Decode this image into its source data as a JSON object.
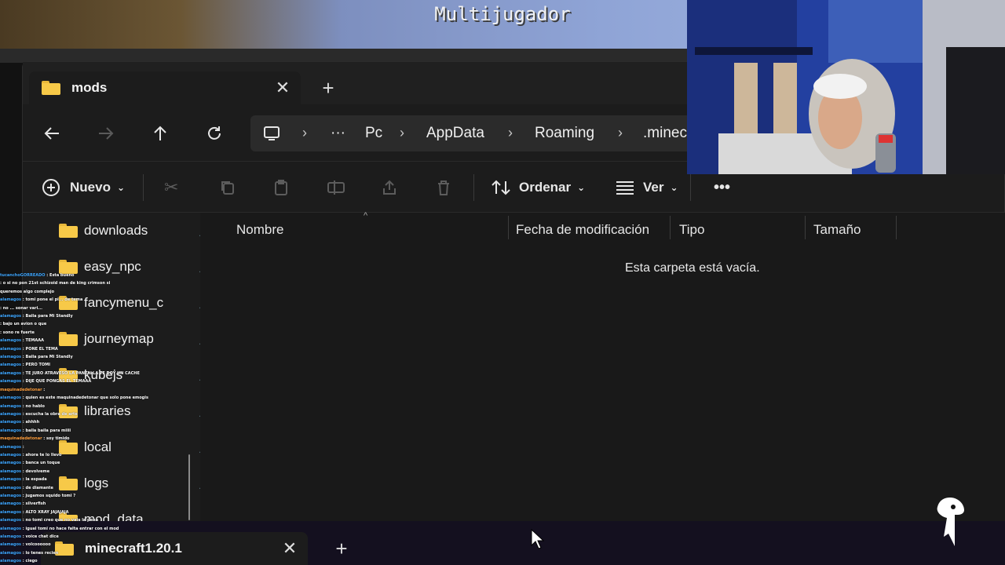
{
  "minecraft": {
    "title": "Multijugador"
  },
  "explorer": {
    "tab": {
      "label": "mods"
    },
    "breadcrumbs": [
      "Pc",
      "AppData",
      "Roaming",
      ".minec"
    ],
    "more_breadcrumbs": "···",
    "commands": {
      "new_label": "Nuevo",
      "sort_label": "Ordenar",
      "view_label": "Ver",
      "more_label": "•••"
    },
    "nav_items": [
      {
        "label": "downloads"
      },
      {
        "label": "easy_npc"
      },
      {
        "label": "fancymenu_c"
      },
      {
        "label": "journeymap"
      },
      {
        "label": "kubejs"
      },
      {
        "label": "libraries"
      },
      {
        "label": "local"
      },
      {
        "label": "logs"
      },
      {
        "label": "mod_data"
      }
    ],
    "columns": [
      "Nombre",
      "Fecha de modificación",
      "Tipo",
      "Tamaño"
    ],
    "empty_message": "Esta carpeta está vacía."
  },
  "bottom_window": {
    "tab": {
      "label": "minecraft1.20.1"
    }
  },
  "chat": [
    {
      "user": "tucanchoGORREADO",
      "text": "Esta bueno"
    },
    {
      "user": "",
      "text": "o si no pon 21st schizoid man de king crimson si"
    },
    {
      "user": "",
      "text": "queremos algo complejo"
    },
    {
      "user": "alamagos",
      "text": "tomi pone el pi... de tema"
    },
    {
      "user": "",
      "text": "no ... sonar vari..."
    },
    {
      "user": "alamagos",
      "text": "Baila para Mi Standly"
    },
    {
      "user": "",
      "text": "bajo un avion o que"
    },
    {
      "user": "",
      "text": "sono re fuerte"
    },
    {
      "user": "alamagos",
      "text": "TEMAAA"
    },
    {
      "user": "alamagos",
      "text": "PONE EL TEMA"
    },
    {
      "user": "alamagos",
      "text": "Baila para Mi Standly"
    },
    {
      "user": "alamagos",
      "text": "PERO TOMI"
    },
    {
      "user": "alamagos",
      "text": "TE JURO ATRAVESO LA PANTALLA TE DOY UN CACHE"
    },
    {
      "user": "alamagos",
      "text": "DIJE QUE PONGAS EL TEMAAA"
    },
    {
      "user": "maquinadedetonar",
      "text": ""
    },
    {
      "user": "alamagos",
      "text": "quien es este maquinadedetonar que solo pone emogis"
    },
    {
      "user": "alamagos",
      "text": "no hablo"
    },
    {
      "user": "alamagos",
      "text": "escucha la obra de arte"
    },
    {
      "user": "alamagos",
      "text": "ahhhh"
    },
    {
      "user": "alamagos",
      "text": "baila baila para miiii"
    },
    {
      "user": "maquinadedetonar",
      "text": "soy timido"
    },
    {
      "user": "alamagos",
      "text": ""
    },
    {
      "user": "alamagos",
      "text": "ahora te lo llevo"
    },
    {
      "user": "alamagos",
      "text": "banca un toque"
    },
    {
      "user": "alamagos",
      "text": "devolveme"
    },
    {
      "user": "alamagos",
      "text": "la espada"
    },
    {
      "user": "alamagos",
      "text": "de diamante"
    },
    {
      "user": "alamagos",
      "text": "jugamos squido tomi ?"
    },
    {
      "user": "alamagos",
      "text": "silverfish"
    },
    {
      "user": "alamagos",
      "text": "ALTO XRAY JAJAJAJA"
    },
    {
      "user": "alamagos",
      "text": "no tomi creo que no vaia la pena"
    },
    {
      "user": "alamagos",
      "text": "igual tomi no hace falta entrar con el mod"
    },
    {
      "user": "alamagos",
      "text": "voice chat dice"
    },
    {
      "user": "alamagos",
      "text": "volcoooooo"
    },
    {
      "user": "alamagos",
      "text": "lo tenes recien"
    },
    {
      "user": "alamagos",
      "text": "ciego"
    }
  ],
  "colors": {
    "folder": "#f7c948",
    "window_bg": "#1c1c1c",
    "chat_user": "#3fa7ff"
  }
}
